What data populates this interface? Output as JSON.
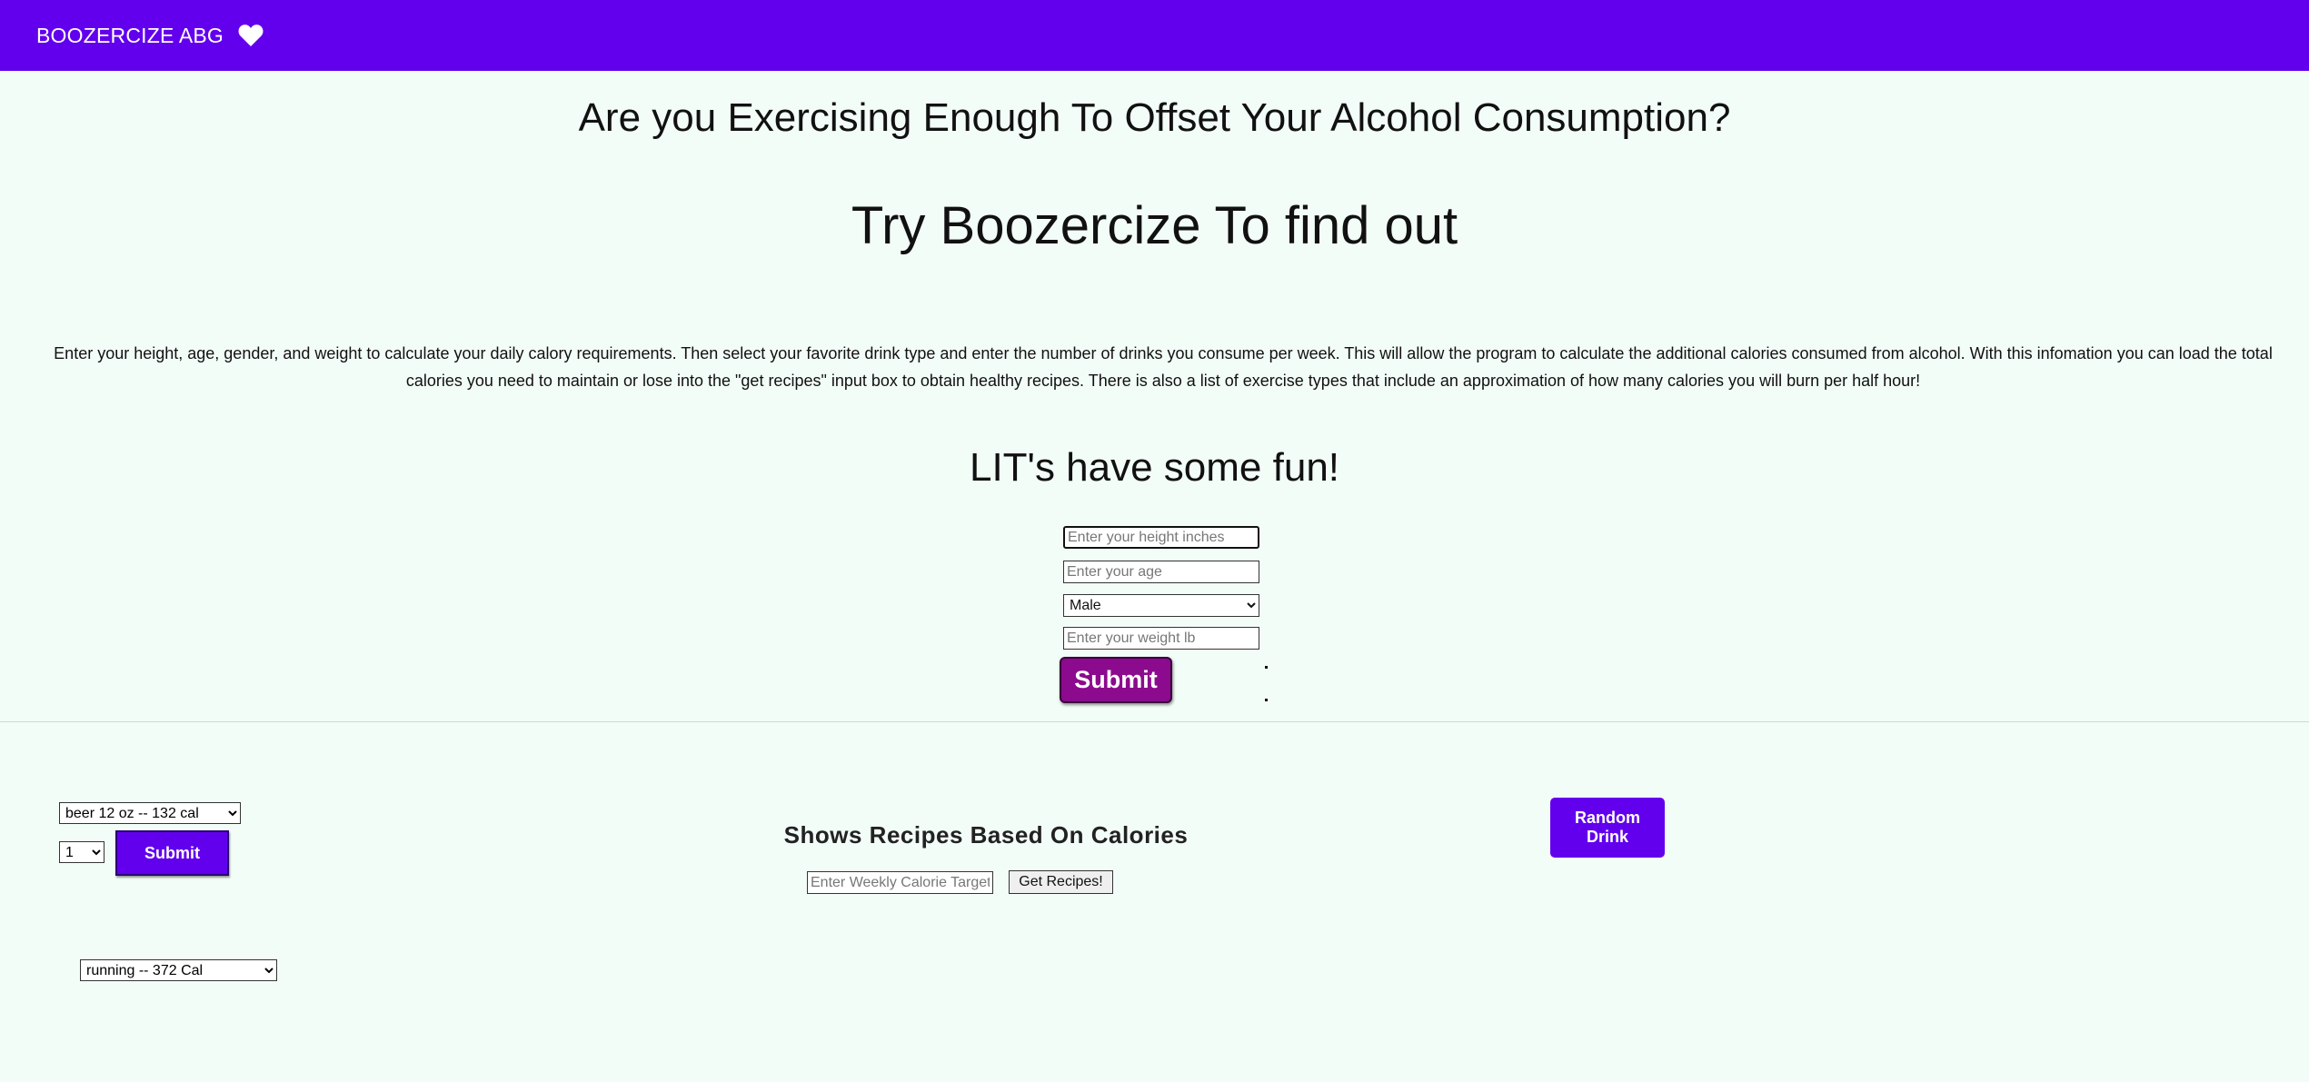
{
  "header": {
    "brand": "BOOZERCIZE ABG",
    "icon": "heart-icon",
    "background_color": "#6200ee"
  },
  "main": {
    "heading": "Are you Exercising Enough To Offset Your Alcohol Consumption?",
    "subheading": "Try Boozercize To find out",
    "intro": "Enter your height, age, gender, and weight to calculate your daily calory requirements. Then select your favorite drink type and enter the number of drinks you consume per week. This will allow the program to calculate the additional calories consumed from alcohol. With this infomation you can load the total calories you need to maintain or lose into the \"get recipes\" input box to obtain healthy recipes. There is also a list of exercise types that include an approximation of how many calories you will burn per half hour!",
    "fun_heading": "LIT's have some fun!"
  },
  "profile_form": {
    "height_placeholder": "Enter your height inches",
    "age_placeholder": "Enter your age",
    "gender_selected": "Male",
    "weight_placeholder": "Enter your weight lb",
    "submit_label": "Submit",
    "submit_color": "#8b0a8d"
  },
  "drink_form": {
    "drink_selected": "beer 12 oz -- 132 cal",
    "quantity_selected": "1",
    "submit_label": "Submit"
  },
  "exercise": {
    "selected": "running -- 372 Cal"
  },
  "recipes": {
    "title": "Shows Recipes Based On Calories",
    "input_placeholder": "Enter Weekly Calorie Target",
    "button_label": "Get Recipes!"
  },
  "random_drink": {
    "label": "Random Drink"
  }
}
